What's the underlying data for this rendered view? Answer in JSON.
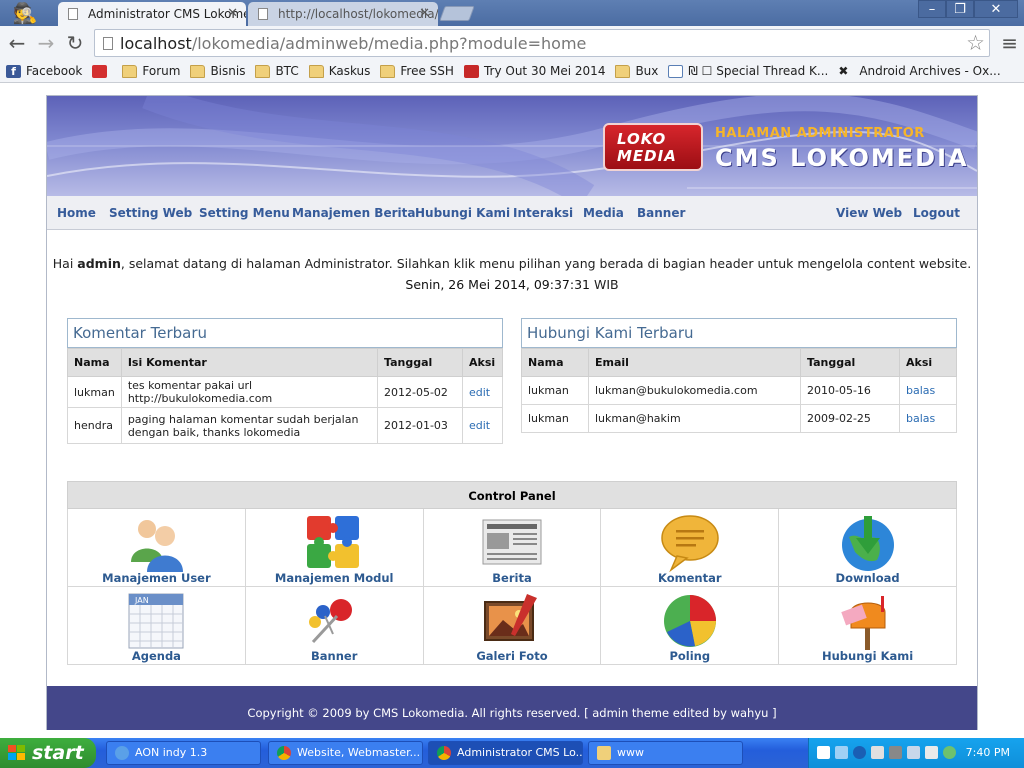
{
  "browser": {
    "tabs": [
      {
        "title": "Administrator CMS Lokomedia",
        "active": true
      },
      {
        "title": "http://localhost/lokomedia/ f",
        "active": false
      }
    ],
    "url_host": "localhost",
    "url_path": "/lokomedia/adminweb/media.php?module=home",
    "bookmarks": [
      {
        "label": "Facebook",
        "icon": "facebook-icon"
      },
      {
        "label": "",
        "icon": "red-logo-icon"
      },
      {
        "label": "Forum",
        "icon": "folder-icon"
      },
      {
        "label": "Bisnis",
        "icon": "folder-icon"
      },
      {
        "label": "BTC",
        "icon": "folder-icon"
      },
      {
        "label": "Kaskus",
        "icon": "folder-icon"
      },
      {
        "label": "Free SSH",
        "icon": "folder-icon"
      },
      {
        "label": "Try Out 30 Mei 2014",
        "icon": "tryout-icon"
      },
      {
        "label": "Bux",
        "icon": "folder-icon"
      },
      {
        "label": "₪ ☐ Special Thread K...",
        "icon": "special-icon"
      },
      {
        "label": "Android Archives - Ox...",
        "icon": "x-icon"
      }
    ]
  },
  "header": {
    "logo_top": "LOKO",
    "logo_bottom": "MEDIA",
    "subtitle": "HALAMAN ADMINISTRATOR",
    "title": "CMS LOKOMEDIA"
  },
  "nav": {
    "left": [
      "Home",
      "Setting Web",
      "Setting Menu",
      "Manajemen Berita",
      "Hubungi Kami",
      "Interaksi",
      "Media",
      "Banner"
    ],
    "right": [
      "View Web",
      "Logout"
    ]
  },
  "greeting": {
    "prefix": "Hai ",
    "user": "admin",
    "suffix": ", selamat datang di halaman Administrator. Silahkan klik menu pilihan yang berada di bagian header untuk mengelola content website.",
    "date": "Senin, 26 Mei 2014, 09:37:31",
    "tz": " WIB"
  },
  "komentar": {
    "title": "Komentar Terbaru",
    "headers": [
      "Nama",
      "Isi Komentar",
      "Tanggal",
      "Aksi"
    ],
    "rows": [
      {
        "nama": "lukman",
        "isi": "tes komentar pakai url http://bukulokomedia.com",
        "tanggal": "2012-05-02",
        "aksi": "edit"
      },
      {
        "nama": "hendra",
        "isi": "paging halaman komentar sudah berjalan dengan baik, thanks lokomedia",
        "tanggal": "2012-01-03",
        "aksi": "edit"
      }
    ]
  },
  "hubungi": {
    "title": "Hubungi Kami Terbaru",
    "headers": [
      "Nama",
      "Email",
      "Tanggal",
      "Aksi"
    ],
    "rows": [
      {
        "nama": "lukman",
        "email": "lukman@bukulokomedia.com",
        "tanggal": "2010-05-16",
        "aksi": "balas"
      },
      {
        "nama": "lukman",
        "email": "lukman@hakim",
        "tanggal": "2009-02-25",
        "aksi": "balas"
      }
    ]
  },
  "control_panel": {
    "title": "Control Panel",
    "items": [
      {
        "label": "Manajemen User",
        "icon": "users-icon"
      },
      {
        "label": "Manajemen Modul",
        "icon": "puzzle-icon"
      },
      {
        "label": "Berita",
        "icon": "newspaper-icon"
      },
      {
        "label": "Komentar",
        "icon": "speech-bubble-icon"
      },
      {
        "label": "Download",
        "icon": "globe-download-icon"
      },
      {
        "label": "Agenda",
        "icon": "calendar-icon"
      },
      {
        "label": "Banner",
        "icon": "pushpin-icon"
      },
      {
        "label": "Galeri Foto",
        "icon": "photo-gallery-icon"
      },
      {
        "label": "Poling",
        "icon": "pie-chart-icon"
      },
      {
        "label": "Hubungi Kami",
        "icon": "mailbox-icon"
      }
    ],
    "calendar_month": "JAN"
  },
  "footer": "Copyright © 2009 by CMS Lokomedia. All rights reserved. [ admin theme edited by wahyu ]",
  "taskbar": {
    "start": "start",
    "tasks": [
      "AON indy 1.3",
      "Website, Webmaster...",
      "Administrator CMS Lo...",
      "www"
    ],
    "clock": "7:40 PM"
  },
  "colors": {
    "nav_link": "#365b9a",
    "panel_title": "#456a92",
    "link": "#2b6cb3",
    "footer_bg": "#44478a",
    "header_sub": "#f6b52a"
  }
}
